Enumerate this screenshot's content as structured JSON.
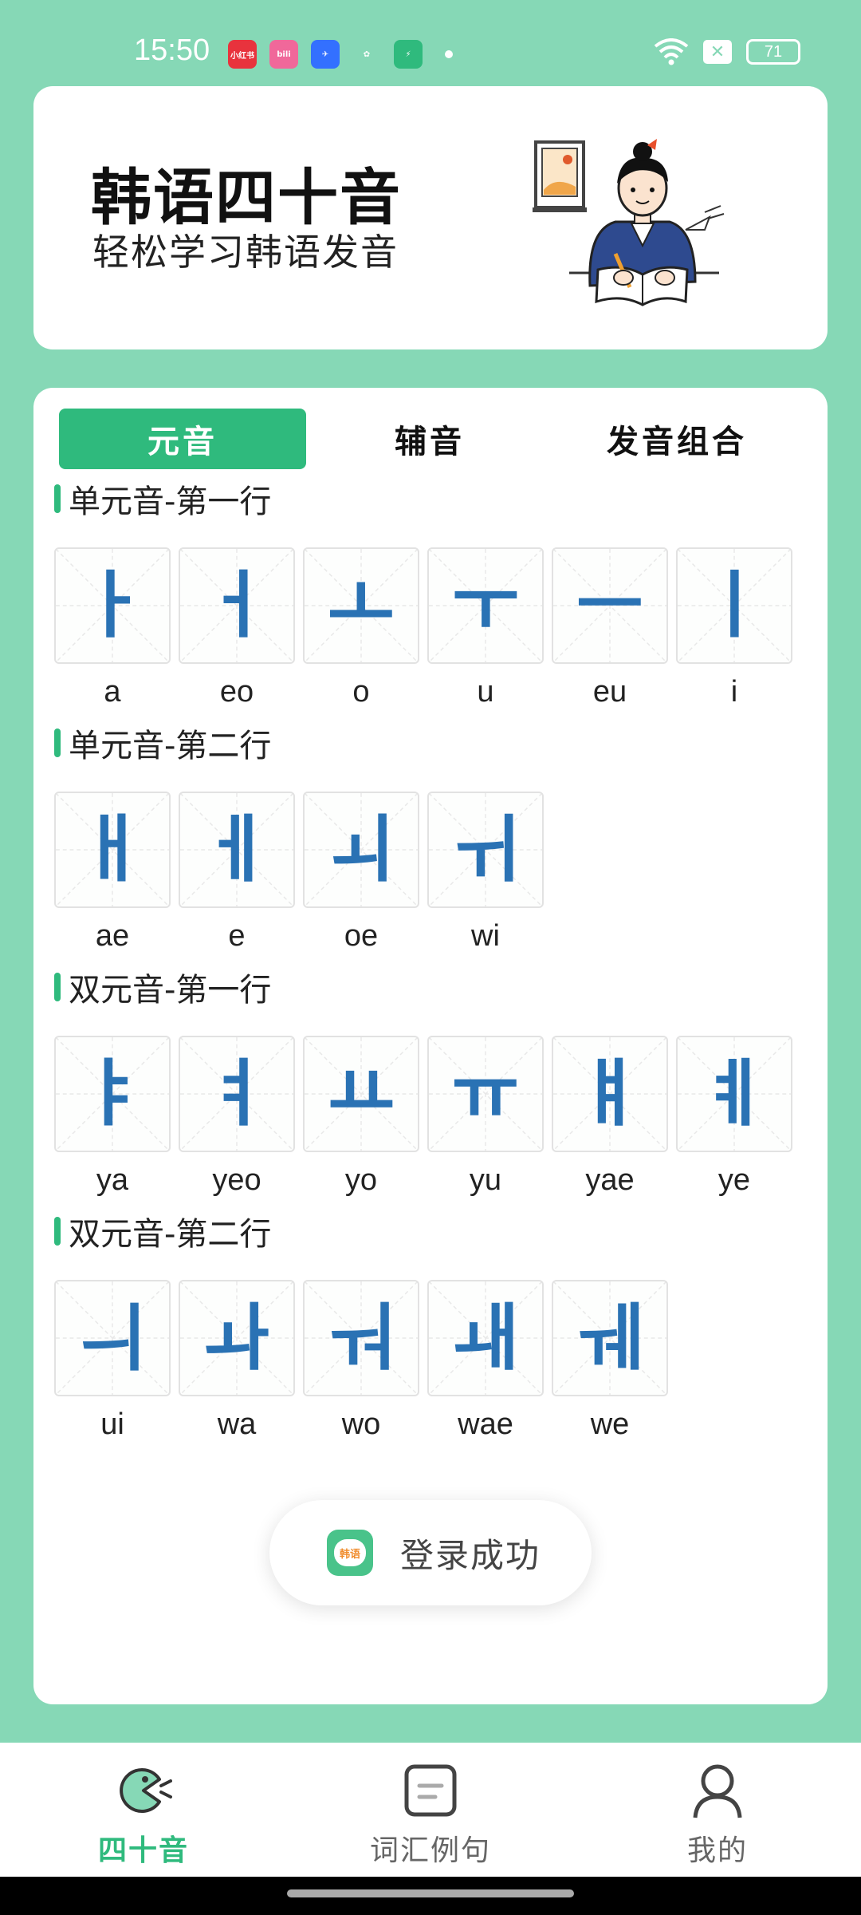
{
  "status_bar": {
    "time": "15:50",
    "battery": "71",
    "app_icons": [
      {
        "name": "xiaohongshu-icon",
        "label": "小红书",
        "color": "#e8333d"
      },
      {
        "name": "bilibili-icon",
        "label": "bili",
        "color": "#f0689a"
      },
      {
        "name": "feishu-icon",
        "label": "✈",
        "color": "#3370ff"
      },
      {
        "name": "clover-icon",
        "label": "✿",
        "color": "#86d8b6"
      },
      {
        "name": "battery-saver-icon",
        "label": "⚡",
        "color": "#2fba7d"
      }
    ]
  },
  "header": {
    "title": "韩语四十音",
    "subtitle": "轻松学习韩语发音"
  },
  "tabs": [
    {
      "label": "元音",
      "active": true
    },
    {
      "label": "辅音",
      "active": false
    },
    {
      "label": "发音组合",
      "active": false
    }
  ],
  "sections": [
    {
      "title": "单元音-第一行",
      "items": [
        {
          "char": "ㅏ",
          "romaji": "a"
        },
        {
          "char": "ㅓ",
          "romaji": "eo"
        },
        {
          "char": "ㅗ",
          "romaji": "o"
        },
        {
          "char": "ㅜ",
          "romaji": "u"
        },
        {
          "char": "ㅡ",
          "romaji": "eu"
        },
        {
          "char": "ㅣ",
          "romaji": "i"
        }
      ]
    },
    {
      "title": "单元音-第二行",
      "items": [
        {
          "char": "ㅐ",
          "romaji": "ae"
        },
        {
          "char": "ㅔ",
          "romaji": "e"
        },
        {
          "char": "ㅚ",
          "romaji": "oe"
        },
        {
          "char": "ㅟ",
          "romaji": "wi"
        }
      ]
    },
    {
      "title": "双元音-第一行",
      "items": [
        {
          "char": "ㅑ",
          "romaji": "ya"
        },
        {
          "char": "ㅕ",
          "romaji": "yeo"
        },
        {
          "char": "ㅛ",
          "romaji": "yo"
        },
        {
          "char": "ㅠ",
          "romaji": "yu"
        },
        {
          "char": "ㅒ",
          "romaji": "yae"
        },
        {
          "char": "ㅖ",
          "romaji": "ye"
        }
      ]
    },
    {
      "title": "双元音-第二行",
      "items": [
        {
          "char": "ㅢ",
          "romaji": "ui"
        },
        {
          "char": "ㅘ",
          "romaji": "wa"
        },
        {
          "char": "ㅝ",
          "romaji": "wo"
        },
        {
          "char": "ㅙ",
          "romaji": "wae"
        },
        {
          "char": "ㅞ",
          "romaji": "we"
        }
      ]
    }
  ],
  "toast": {
    "icon_label": "韩语",
    "text": "登录成功"
  },
  "bottom_nav": [
    {
      "label": "四十音",
      "icon": "pacman-icon",
      "active": true
    },
    {
      "label": "词汇例句",
      "icon": "document-icon",
      "active": false
    },
    {
      "label": "我的",
      "icon": "person-icon",
      "active": false
    }
  ],
  "colors": {
    "background": "#86d8b6",
    "accent": "#2fba7d",
    "hangul": "#2a72b4"
  }
}
